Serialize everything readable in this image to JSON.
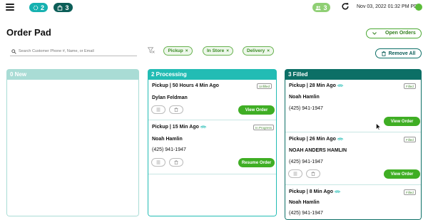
{
  "header": {
    "badge_processing_count": "2",
    "badge_orders_count": "3",
    "badge_users_count": "3",
    "datetime": "Nov 03, 2022 01:32 PM PDT"
  },
  "page": {
    "title": "Order Pad",
    "open_orders_label": "Open Orders"
  },
  "search": {
    "placeholder": "Search Customer Phone #, Name, or Email"
  },
  "filters": [
    {
      "label": "Pickup"
    },
    {
      "label": "In Store"
    },
    {
      "label": "Delivery"
    }
  ],
  "remove_all_label": "Remove All",
  "columns": {
    "new": {
      "title": "0 New"
    },
    "processing": {
      "title": "2 Processing",
      "orders": [
        {
          "title": "Pickup | 50 Hours 4 Min Ago",
          "status": "Unfilled",
          "name": "Dylan Feldman",
          "phone": "",
          "action": "View Order"
        },
        {
          "title": "Pickup | 15 Min Ago",
          "status": "In Progress",
          "name": "Noah Hamlin",
          "phone": "(425) 941-1947",
          "action": "Resume Order"
        }
      ]
    },
    "filled": {
      "title": "3 Filled",
      "orders": [
        {
          "title": "Pickup | 28 Min Ago",
          "status": "Filled",
          "name": "Noah Hamlin",
          "phone": "(425) 941-1947",
          "action": "View Order"
        },
        {
          "title": "Pickup | 26 Min Ago",
          "status": "Filled",
          "name": "NOAH ANDERS HAMLIN",
          "phone": "(425) 941-1947",
          "action": "View Order"
        },
        {
          "title": "Pickup | 8 Min Ago",
          "status": "Filled",
          "name": "Noah Hamlin",
          "phone": "(425) 941-1947"
        }
      ]
    }
  },
  "colors": {
    "accent_green": "#3fae24",
    "teal": "#22bcb4",
    "dark_teal": "#0c6f66"
  }
}
